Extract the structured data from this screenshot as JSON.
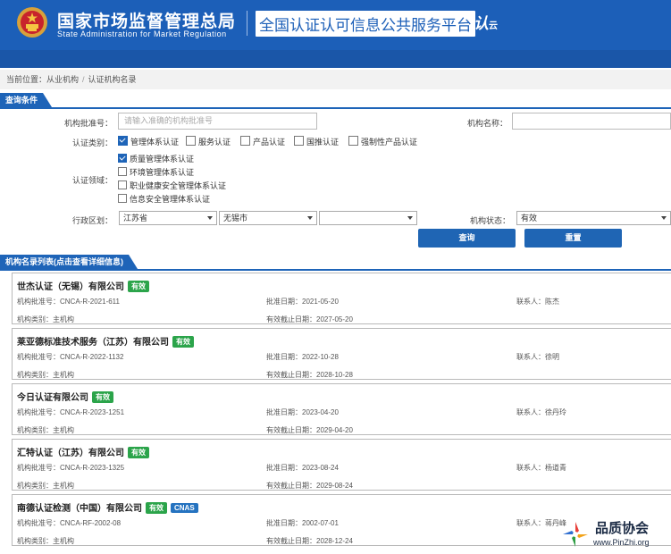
{
  "header": {
    "org_name": "国家市场监督管理总局",
    "org_en": "State Administration for Market Regulation",
    "platform_title": "全国认证认可信息公共服务平台",
    "logo_text": "认",
    "logo_sub": "云"
  },
  "breadcrumb": {
    "prefix": "当前位置：",
    "items": [
      "从业机构",
      "认证机构名录"
    ],
    "separator": "/"
  },
  "query": {
    "section_title": "查询条件",
    "approval_label": "机构批准号：",
    "approval_placeholder": "请输入准确的机构批准号",
    "name_label": "机构名称：",
    "name_value": "",
    "type_label": "认证类别：",
    "types": [
      {
        "label": "管理体系认证",
        "checked": true
      },
      {
        "label": "服务认证",
        "checked": false
      },
      {
        "label": "产品认证",
        "checked": false
      },
      {
        "label": "国推认证",
        "checked": false
      },
      {
        "label": "强制性产品认证",
        "checked": false
      }
    ],
    "field_label": "认证领域：",
    "fields": [
      {
        "label": "质量管理体系认证",
        "checked": true
      },
      {
        "label": "环境管理体系认证",
        "checked": false
      },
      {
        "label": "职业健康安全管理体系认证",
        "checked": false
      },
      {
        "label": "信息安全管理体系认证",
        "checked": false
      }
    ],
    "region_label": "行政区划：",
    "province": "江苏省",
    "city": "无锡市",
    "district": "",
    "status_label": "机构状态：",
    "status_value": "有效",
    "search_button": "查询",
    "reset_button": "重置"
  },
  "results": {
    "section_title": "机构名录列表(点击查看详细信息)",
    "labels": {
      "approval": "机构批准号：",
      "date": "批准日期：",
      "contact": "联系人：",
      "category": "机构类别：",
      "expiry": "有效截止日期："
    },
    "items": [
      {
        "name": "世杰认证（无锡）有限公司",
        "badges": [
          "有效"
        ],
        "approval": "CNCA-R-2021-611",
        "date": "2021-05-20",
        "contact": "陈杰",
        "category": "主机构",
        "expiry": "2027-05-20"
      },
      {
        "name": "莱亚德标准技术服务（江苏）有限公司",
        "badges": [
          "有效"
        ],
        "approval": "CNCA-R-2022-1132",
        "date": "2022-10-28",
        "contact": "徐明",
        "category": "主机构",
        "expiry": "2028-10-28"
      },
      {
        "name": "今日认证有限公司",
        "badges": [
          "有效"
        ],
        "approval": "CNCA-R-2023-1251",
        "date": "2023-04-20",
        "contact": "徐丹玲",
        "category": "主机构",
        "expiry": "2029-04-20"
      },
      {
        "name": "汇特认证（江苏）有限公司",
        "badges": [
          "有效"
        ],
        "approval": "CNCA-R-2023-1325",
        "date": "2023-08-24",
        "contact": "杨道青",
        "category": "主机构",
        "expiry": "2029-08-24"
      },
      {
        "name": "南德认证检测（中国）有限公司",
        "badges": [
          "有效",
          "CNAS"
        ],
        "approval": "CNCA-RF-2002-08",
        "date": "2002-07-01",
        "contact": "蒋丹峰",
        "category": "主机构",
        "expiry": "2028-12-24"
      }
    ]
  },
  "watermark": {
    "title": "品质协会",
    "url": "www.PinZhi.org"
  },
  "colors": {
    "header_blue": "#1c5fb8",
    "section_blue": "#1e64b8",
    "badge_green": "#2ba44a",
    "badge_blue": "#2573c0"
  }
}
